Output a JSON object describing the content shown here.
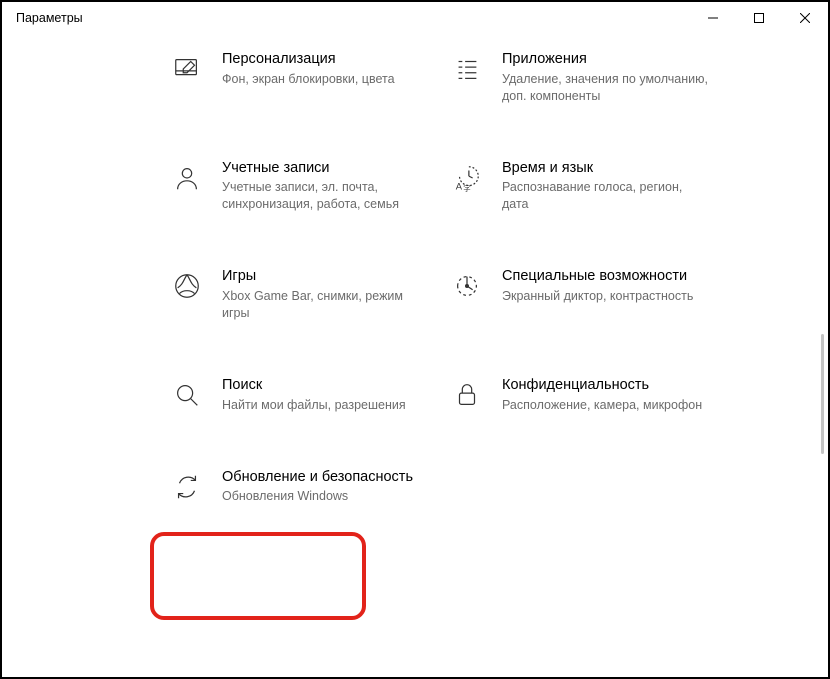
{
  "window": {
    "title": "Параметры"
  },
  "tiles": {
    "personalization": {
      "title": "Персонализация",
      "desc": "Фон, экран блокировки, цвета"
    },
    "apps": {
      "title": "Приложения",
      "desc": "Удаление, значения по умолчанию, доп. компоненты"
    },
    "accounts": {
      "title": "Учетные записи",
      "desc": "Учетные записи, эл. почта, синхронизация, работа, семья"
    },
    "time_lang": {
      "title": "Время и язык",
      "desc": "Распознавание голоса, регион, дата"
    },
    "gaming": {
      "title": "Игры",
      "desc": "Xbox Game Bar, снимки, режим игры"
    },
    "accessibility": {
      "title": "Специальные возможности",
      "desc": "Экранный диктор, контрастность"
    },
    "search": {
      "title": "Поиск",
      "desc": "Найти мои файлы, разрешения"
    },
    "privacy": {
      "title": "Конфиденциальность",
      "desc": "Расположение, камера, микрофон"
    },
    "update": {
      "title": "Обновление и безопасность",
      "desc": "Обновления Windows"
    }
  }
}
